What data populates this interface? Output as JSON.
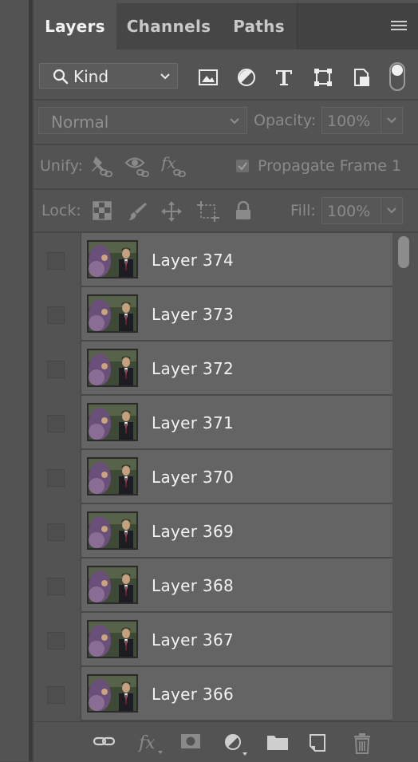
{
  "tabs": [
    {
      "label": "Layers",
      "active": true
    },
    {
      "label": "Channels",
      "active": false
    },
    {
      "label": "Paths",
      "active": false
    }
  ],
  "filter": {
    "kind_label": "Kind",
    "icons": [
      "image-filter-icon",
      "adjustment-filter-icon",
      "type-filter-icon",
      "shape-filter-icon",
      "smart-object-filter-icon"
    ],
    "toggle_on": true
  },
  "blend": {
    "mode": "Normal",
    "opacity_label": "Opacity:",
    "opacity_value": "100%"
  },
  "unify": {
    "label": "Unify:",
    "propagate_label": "Propagate Frame 1",
    "propagate_checked": true
  },
  "lock": {
    "label": "Lock:",
    "fill_label": "Fill:",
    "fill_value": "100%"
  },
  "layers": [
    {
      "name": "Layer 374"
    },
    {
      "name": "Layer 373"
    },
    {
      "name": "Layer 372"
    },
    {
      "name": "Layer 371"
    },
    {
      "name": "Layer 370"
    },
    {
      "name": "Layer 369"
    },
    {
      "name": "Layer 368"
    },
    {
      "name": "Layer 367"
    },
    {
      "name": "Layer 366"
    }
  ],
  "footer_icons": [
    "link-layers-icon",
    "fx-icon",
    "add-mask-icon",
    "new-adjustment-icon",
    "new-group-icon",
    "new-layer-icon",
    "delete-layer-icon"
  ],
  "colors": {
    "panel_bg": "#535353",
    "layer_row_bg": "#646464",
    "text": "#f2f2f2",
    "dim_text": "#8a8a8a"
  }
}
